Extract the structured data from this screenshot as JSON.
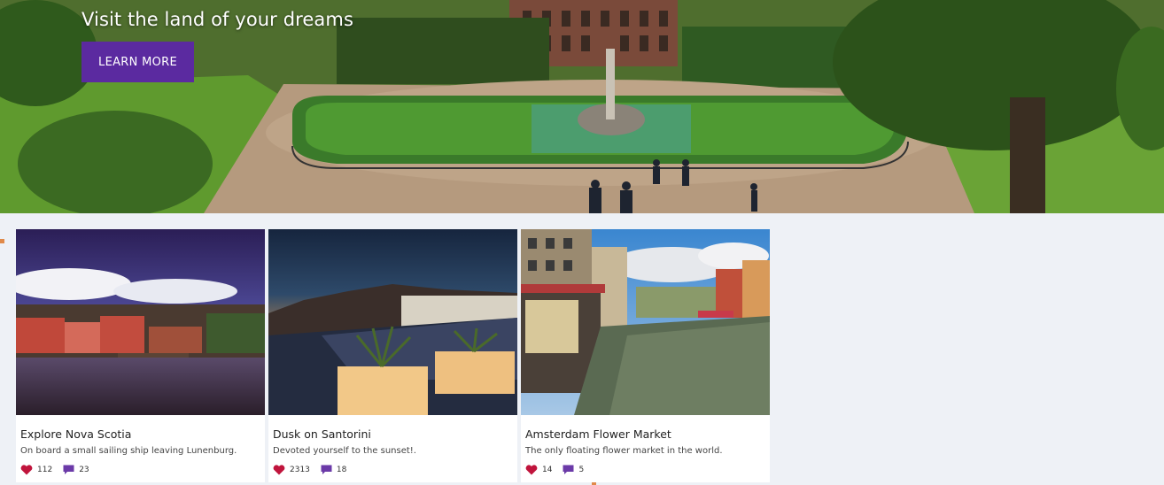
{
  "hero": {
    "title": "Visit the land of your dreams",
    "button_label": "LEARN MORE"
  },
  "accent_color": "#5b2aa0",
  "like_color": "#c0143c",
  "comment_color": "#6b3aa8",
  "cards": [
    {
      "title": "Explore Nova Scotia",
      "description": "On board a small sailing ship leaving Lunenburg.",
      "likes": "112",
      "comments": "23"
    },
    {
      "title": "Dusk on Santorini",
      "description": "Devoted yourself to the sunset!.",
      "likes": "2313",
      "comments": "18"
    },
    {
      "title": "Amsterdam Flower Market",
      "description": "The only floating flower market in the world.",
      "likes": "14",
      "comments": "5"
    }
  ]
}
